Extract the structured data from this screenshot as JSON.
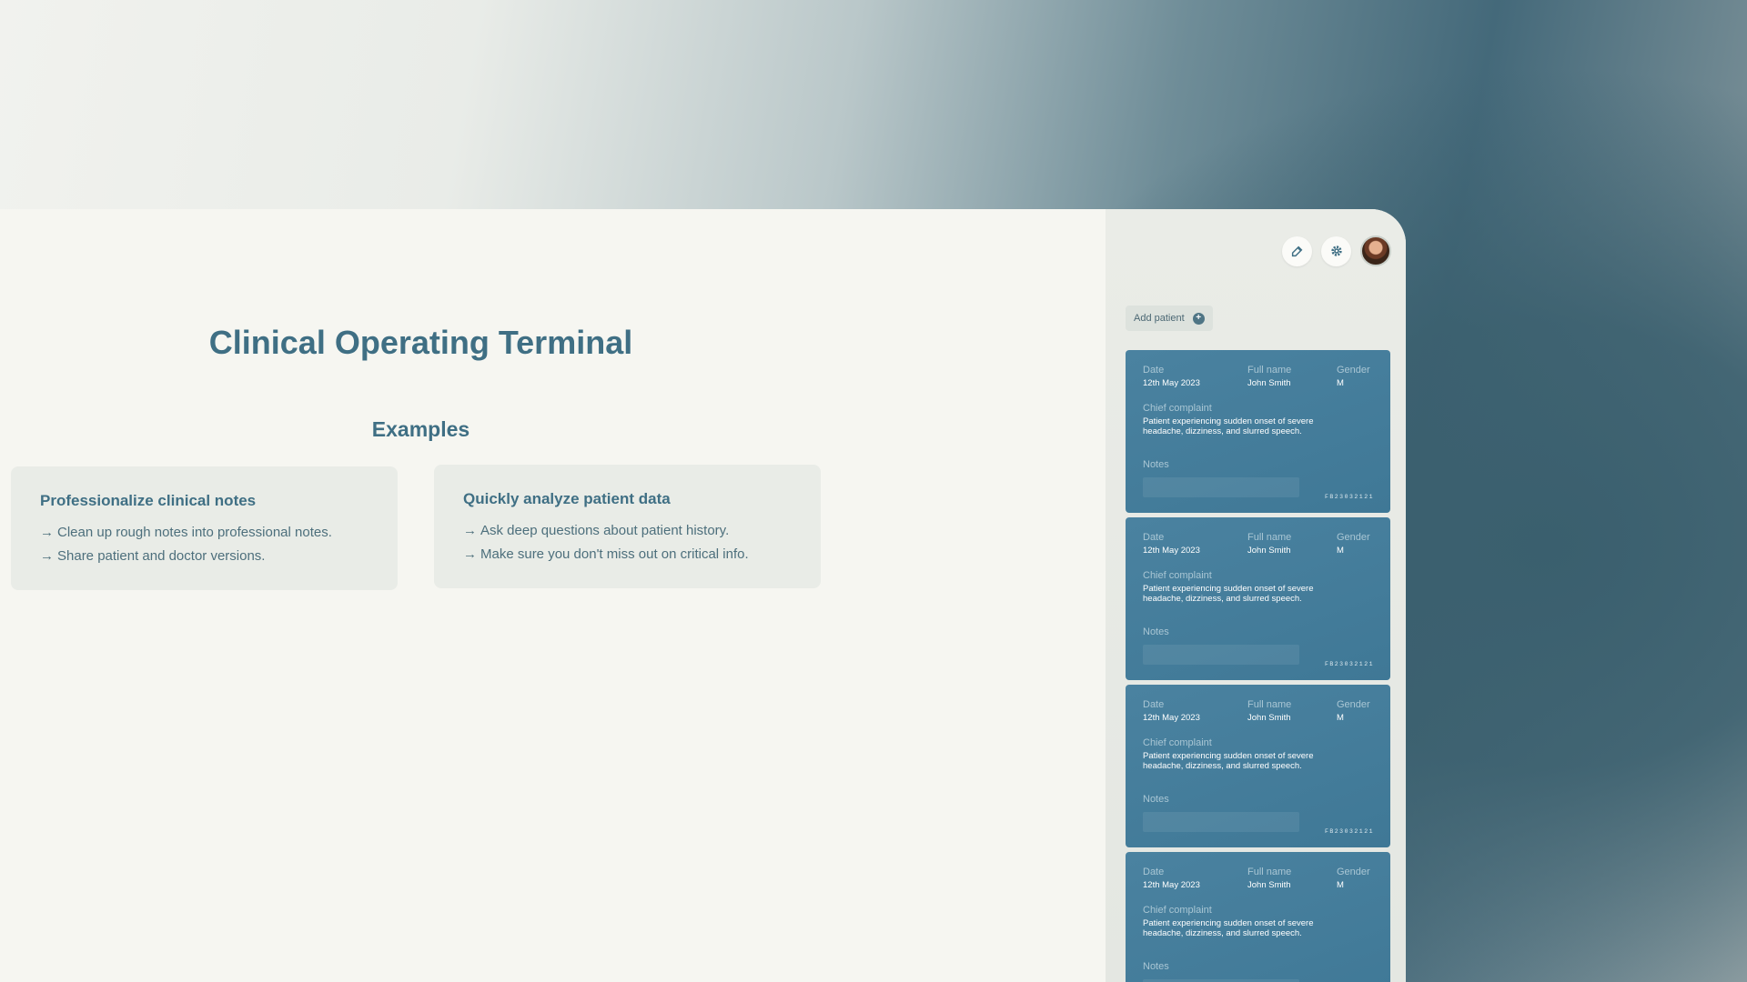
{
  "main": {
    "title": "Clinical Operating Terminal",
    "examples_heading": "Examples",
    "cards": [
      {
        "title": "Professionalize clinical notes",
        "items": [
          "Clean up rough notes into professional notes.",
          "Share patient and doctor versions."
        ]
      },
      {
        "title": "Quickly analyze patient data",
        "items": [
          "Ask deep questions about patient history.",
          "Make sure you don't miss out on critical info."
        ]
      }
    ],
    "arrow": "→"
  },
  "sidebar": {
    "icons": {
      "edit": "edit-icon",
      "settings": "gear-icon"
    },
    "add_patient_label": "Add patient",
    "labels": {
      "date": "Date",
      "full_name": "Full name",
      "gender": "Gender",
      "chief_complaint": "Chief complaint",
      "notes": "Notes"
    },
    "patients": [
      {
        "date": "12th May 2023",
        "name": "John Smith",
        "gender": "M",
        "complaint": "Patient experiencing sudden onset of severe headache, dizziness, and slurred speech.",
        "id": "FB23032121"
      },
      {
        "date": "12th May 2023",
        "name": "John Smith",
        "gender": "M",
        "complaint": "Patient experiencing sudden onset of severe headache, dizziness, and slurred speech.",
        "id": "FB23032121"
      },
      {
        "date": "12th May 2023",
        "name": "John Smith",
        "gender": "M",
        "complaint": "Patient experiencing sudden onset of severe headache, dizziness, and slurred speech.",
        "id": "FB23032121"
      },
      {
        "date": "12th May 2023",
        "name": "John Smith",
        "gender": "M",
        "complaint": "Patient experiencing sudden onset of severe headache, dizziness, and slurred speech.",
        "id": ""
      }
    ]
  },
  "colors": {
    "accent": "#3f6f84",
    "card_blue": "#4a82a0",
    "panel": "#f6f6f1"
  }
}
